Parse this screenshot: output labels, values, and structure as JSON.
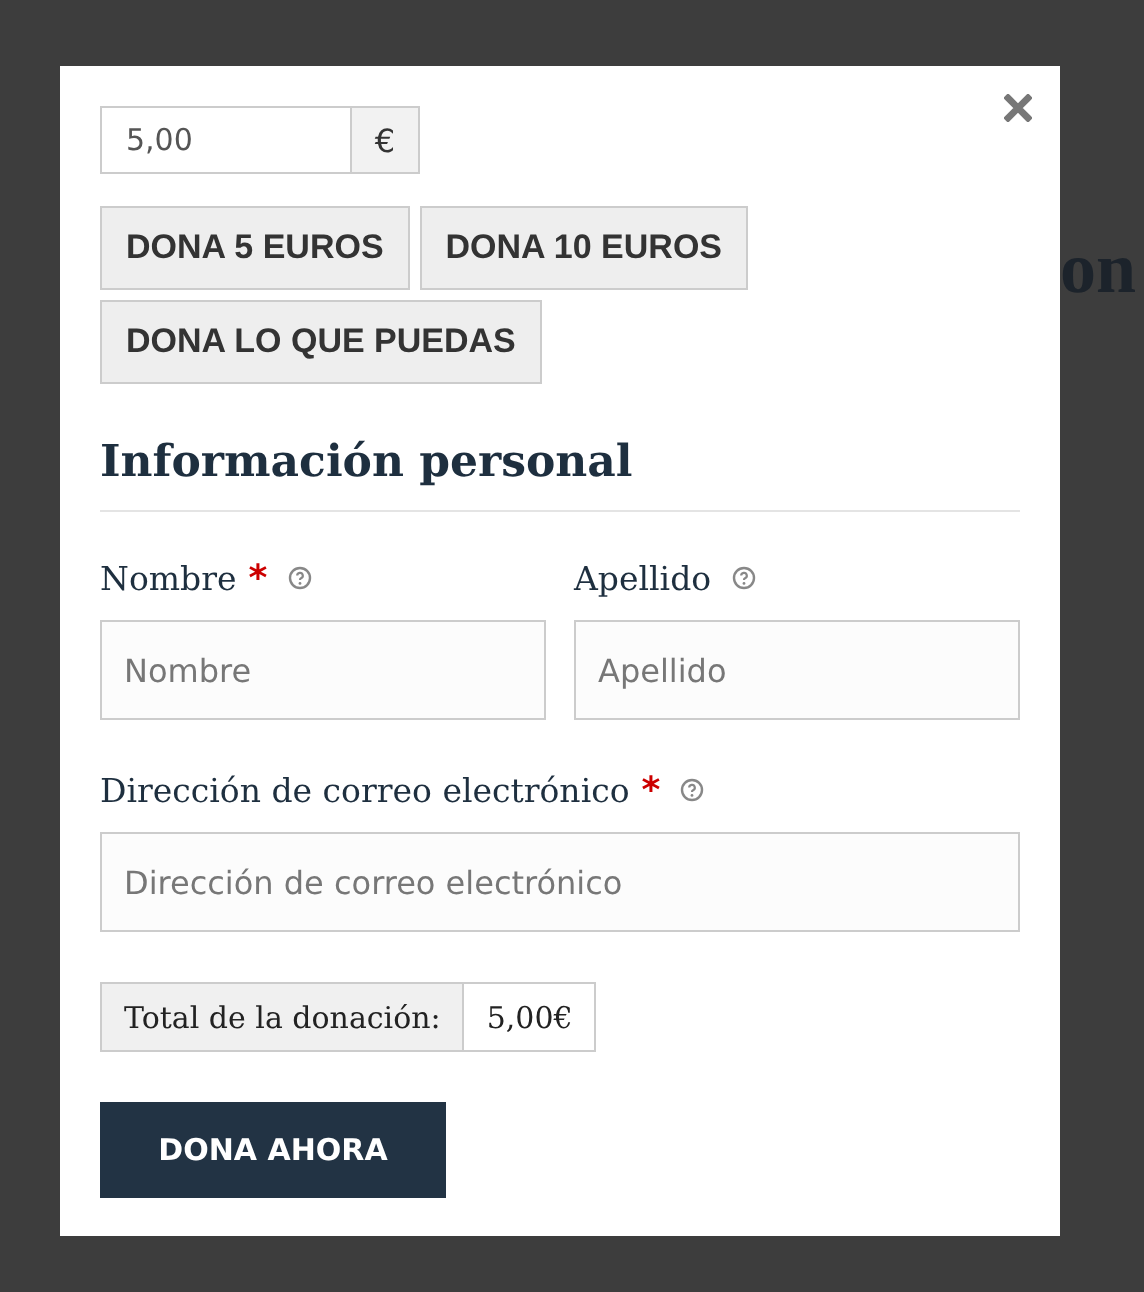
{
  "background_text": "on",
  "amount": {
    "value": "5,00",
    "currency": "€"
  },
  "preset_buttons": [
    "DONA 5 EUROS",
    "DONA 10 EUROS",
    "DONA LO QUE PUEDAS"
  ],
  "section_title": "Información personal",
  "fields": [
    {
      "kind": "half",
      "label": "Nombre",
      "required_mark": "*",
      "help": true,
      "placeholder": "Nombre"
    },
    {
      "kind": "half",
      "label": "Apellido",
      "help": true,
      "placeholder": "Apellido"
    },
    {
      "kind": "full",
      "label": "Dirección de correo electrónico",
      "required_mark": "*",
      "help": true,
      "placeholder": "Dirección de correo electrónico"
    }
  ],
  "total": {
    "label": "Total de la donación:",
    "value": "5,00€"
  },
  "submit": "DONA AHORA"
}
